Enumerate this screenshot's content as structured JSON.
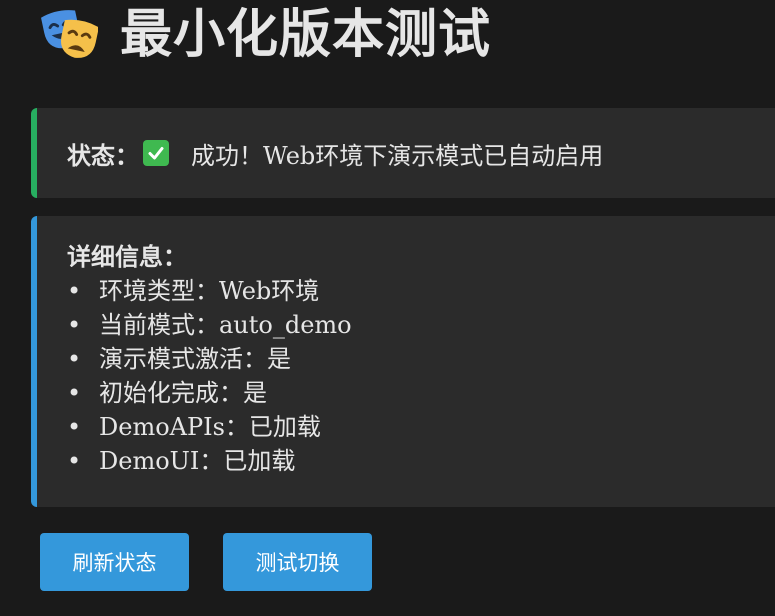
{
  "header": {
    "logo_icon": "performing-arts-masks-icon",
    "title": "最小化版本测试"
  },
  "status": {
    "label": "状态：",
    "icon": "check-mark-button-icon",
    "text": "成功！Web环境下演示模式已自动启用",
    "accent_color": "#27ae60"
  },
  "details": {
    "title": "详细信息：",
    "bullet": "•",
    "accent_color": "#3498db",
    "items": [
      {
        "text": "环境类型：Web环境"
      },
      {
        "text": "当前模式：auto_demo"
      },
      {
        "text": "演示模式激活：是"
      },
      {
        "text": "初始化完成：是"
      },
      {
        "text": "DemoAPIs：已加载"
      },
      {
        "text": "DemoUI：已加载"
      }
    ]
  },
  "buttons": {
    "refresh_label": "刷新状态",
    "toggle_label": "测试切换",
    "color": "#3498db"
  }
}
